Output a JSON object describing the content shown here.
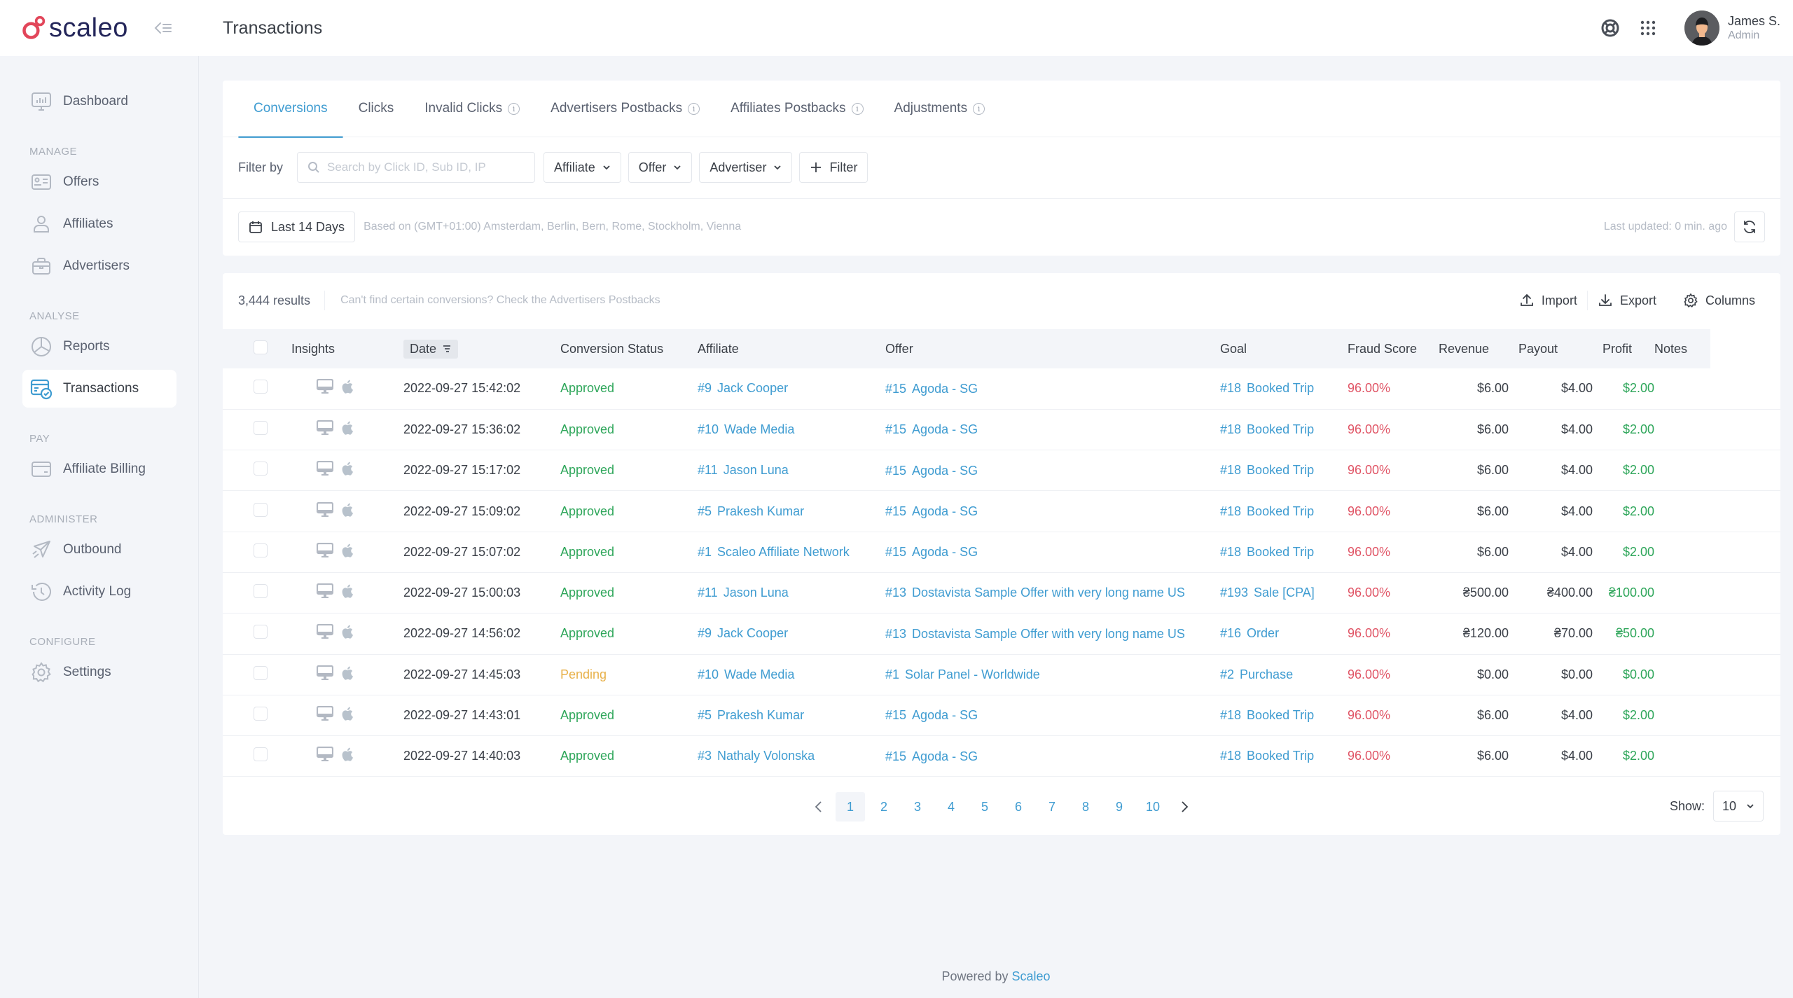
{
  "app": {
    "brand": "scaleo",
    "page_title": "Transactions",
    "colors": {
      "accent": "#3f9cd1",
      "brand_red": "#e2465a",
      "brand_navy": "#24265a",
      "approved": "#2ea65a",
      "pending": "#e8b14a",
      "fraud": "#e05465"
    }
  },
  "header": {
    "help_icon": "lifebuoy-icon",
    "apps_icon": "grid-icon",
    "user": {
      "name": "James S.",
      "role": "Admin"
    }
  },
  "sidebar": {
    "items": [
      {
        "label": "Dashboard",
        "icon": "dashboard-icon",
        "section": ""
      },
      {
        "label": "Offers",
        "icon": "offers-icon",
        "section": "Manage"
      },
      {
        "label": "Affiliates",
        "icon": "affiliates-icon",
        "section": "Manage"
      },
      {
        "label": "Advertisers",
        "icon": "briefcase-icon",
        "section": "Manage"
      },
      {
        "label": "Reports",
        "icon": "pie-chart-icon",
        "section": "Analyse"
      },
      {
        "label": "Transactions",
        "icon": "transactions-icon",
        "section": "Analyse",
        "active": true
      },
      {
        "label": "Affiliate Billing",
        "icon": "credit-card-icon",
        "section": "Pay"
      },
      {
        "label": "Outbound",
        "icon": "paper-plane-icon",
        "section": "Administer"
      },
      {
        "label": "Activity Log",
        "icon": "history-icon",
        "section": "Administer"
      },
      {
        "label": "Settings",
        "icon": "gear-icon",
        "section": "Configure"
      }
    ],
    "sections": {
      "manage": "Manage",
      "analyse": "Analyse",
      "pay": "Pay",
      "administer": "Administer",
      "configure": "Configure"
    }
  },
  "tabs": [
    {
      "label": "Conversions",
      "active": true,
      "info": false
    },
    {
      "label": "Clicks",
      "active": false,
      "info": false
    },
    {
      "label": "Invalid Clicks",
      "active": false,
      "info": true
    },
    {
      "label": "Advertisers Postbacks",
      "active": false,
      "info": true
    },
    {
      "label": "Affiliates Postbacks",
      "active": false,
      "info": true
    },
    {
      "label": "Adjustments",
      "active": false,
      "info": true
    }
  ],
  "filters": {
    "label": "Filter by",
    "search_placeholder": "Search by Click ID, Sub ID, IP",
    "search_value": "",
    "dropdowns": [
      "Affiliate",
      "Offer",
      "Advertiser"
    ],
    "add_filter": "Filter",
    "date_range": "Last 14 Days",
    "timezone_note": "Based on (GMT+01:00) Amsterdam, Berlin, Bern, Rome, Stockholm, Vienna",
    "last_updated": "Last updated: 0 min. ago"
  },
  "results": {
    "count": "3,444 results",
    "hint": "Can't find certain conversions? Check the Advertisers Postbacks",
    "import": "Import",
    "export": "Export",
    "columns": "Columns"
  },
  "table": {
    "headers": [
      "Insights",
      "Date",
      "Conversion Status",
      "Affiliate",
      "Offer",
      "Goal",
      "Fraud Score",
      "Revenue",
      "Payout",
      "Profit",
      "Notes"
    ],
    "rows": [
      {
        "date": "2022-09-27 15:42:02",
        "status": "Approved",
        "affiliate_id": "#9",
        "affiliate": "Jack Cooper",
        "offer_id": "#15",
        "offer": "Agoda - SG",
        "goal_id": "#18",
        "goal": "Booked Trip",
        "fraud": "96.00%",
        "revenue": "$6.00",
        "payout": "$4.00",
        "profit": "$2.00",
        "notes": ""
      },
      {
        "date": "2022-09-27 15:36:02",
        "status": "Approved",
        "affiliate_id": "#10",
        "affiliate": "Wade Media",
        "offer_id": "#15",
        "offer": "Agoda - SG",
        "goal_id": "#18",
        "goal": "Booked Trip",
        "fraud": "96.00%",
        "revenue": "$6.00",
        "payout": "$4.00",
        "profit": "$2.00",
        "notes": ""
      },
      {
        "date": "2022-09-27 15:17:02",
        "status": "Approved",
        "affiliate_id": "#11",
        "affiliate": "Jason Luna",
        "offer_id": "#15",
        "offer": "Agoda - SG",
        "goal_id": "#18",
        "goal": "Booked Trip",
        "fraud": "96.00%",
        "revenue": "$6.00",
        "payout": "$4.00",
        "profit": "$2.00",
        "notes": ""
      },
      {
        "date": "2022-09-27 15:09:02",
        "status": "Approved",
        "affiliate_id": "#5",
        "affiliate": "Prakesh Kumar",
        "offer_id": "#15",
        "offer": "Agoda - SG",
        "goal_id": "#18",
        "goal": "Booked Trip",
        "fraud": "96.00%",
        "revenue": "$6.00",
        "payout": "$4.00",
        "profit": "$2.00",
        "notes": ""
      },
      {
        "date": "2022-09-27 15:07:02",
        "status": "Approved",
        "affiliate_id": "#1",
        "affiliate": "Scaleo Affiliate Network",
        "offer_id": "#15",
        "offer": "Agoda - SG",
        "goal_id": "#18",
        "goal": "Booked Trip",
        "fraud": "96.00%",
        "revenue": "$6.00",
        "payout": "$4.00",
        "profit": "$2.00",
        "notes": ""
      },
      {
        "date": "2022-09-27 15:00:03",
        "status": "Approved",
        "affiliate_id": "#11",
        "affiliate": "Jason Luna",
        "offer_id": "#13",
        "offer": "Dostavista Sample Offer with very long name US",
        "goal_id": "#193",
        "goal": "Sale [CPA]",
        "fraud": "96.00%",
        "revenue": "₴500.00",
        "payout": "₴400.00",
        "profit": "₴100.00",
        "notes": ""
      },
      {
        "date": "2022-09-27 14:56:02",
        "status": "Approved",
        "affiliate_id": "#9",
        "affiliate": "Jack Cooper",
        "offer_id": "#13",
        "offer": "Dostavista Sample Offer with very long name US",
        "goal_id": "#16",
        "goal": "Order",
        "fraud": "96.00%",
        "revenue": "₴120.00",
        "payout": "₴70.00",
        "profit": "₴50.00",
        "notes": ""
      },
      {
        "date": "2022-09-27 14:45:03",
        "status": "Pending",
        "affiliate_id": "#10",
        "affiliate": "Wade Media",
        "offer_id": "#1",
        "offer": "Solar Panel - Worldwide",
        "goal_id": "#2",
        "goal": "Purchase",
        "fraud": "96.00%",
        "revenue": "$0.00",
        "payout": "$0.00",
        "profit": "$0.00",
        "notes": ""
      },
      {
        "date": "2022-09-27 14:43:01",
        "status": "Approved",
        "affiliate_id": "#5",
        "affiliate": "Prakesh Kumar",
        "offer_id": "#15",
        "offer": "Agoda - SG",
        "goal_id": "#18",
        "goal": "Booked Trip",
        "fraud": "96.00%",
        "revenue": "$6.00",
        "payout": "$4.00",
        "profit": "$2.00",
        "notes": ""
      },
      {
        "date": "2022-09-27 14:40:03",
        "status": "Approved",
        "affiliate_id": "#3",
        "affiliate": "Nathaly Volonska",
        "offer_id": "#15",
        "offer": "Agoda - SG",
        "goal_id": "#18",
        "goal": "Booked Trip",
        "fraud": "96.00%",
        "revenue": "$6.00",
        "payout": "$4.00",
        "profit": "$2.00",
        "notes": ""
      }
    ]
  },
  "pagination": {
    "pages": [
      "1",
      "2",
      "3",
      "4",
      "5",
      "6",
      "7",
      "8",
      "9",
      "10"
    ],
    "current": "1",
    "show_label": "Show:",
    "page_size": "10"
  },
  "footer": {
    "prefix": "Powered by",
    "brand_link": "Scaleo"
  }
}
